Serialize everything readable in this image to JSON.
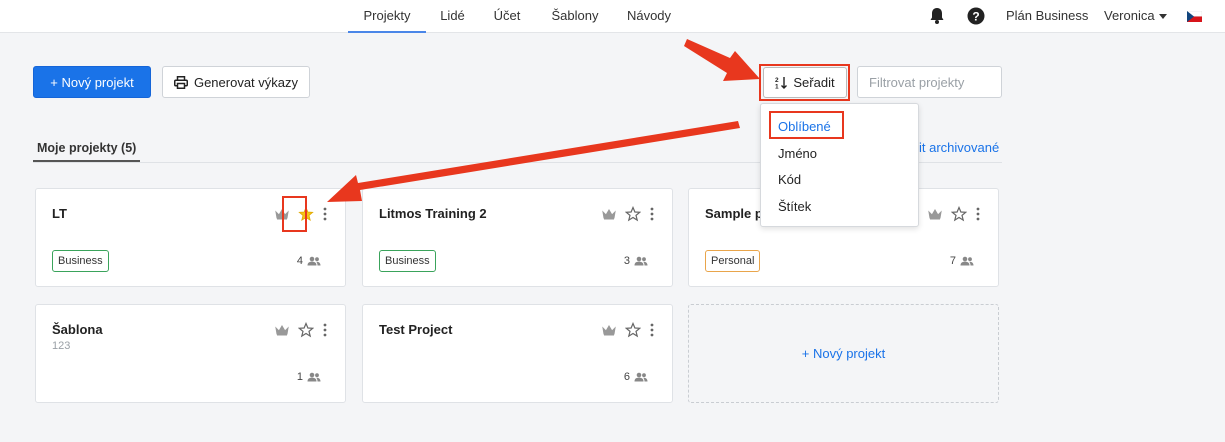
{
  "nav": {
    "items": [
      {
        "label": "Projekty",
        "active": true
      },
      {
        "label": "Lidé"
      },
      {
        "label": "Účet"
      },
      {
        "label": "Šablony"
      },
      {
        "label": "Návody"
      }
    ],
    "plan_label": "Plán Business",
    "user_name": "Veronica",
    "icons": [
      "bell-icon",
      "help-icon",
      "czech-flag-icon"
    ]
  },
  "toolbar": {
    "new_project_label": "+ Nový projekt",
    "reports_label": "Generovat výkazy",
    "sort_label": "Seřadit",
    "filter_placeholder": "Filtrovat projekty"
  },
  "sort_menu": {
    "options": [
      "Oblíbené",
      "Jméno",
      "Kód",
      "Štítek"
    ],
    "selected": "Oblíbené"
  },
  "section": {
    "tab_label": "Moje projekty (5)",
    "archived_link": "it archivované"
  },
  "projects": [
    {
      "name": "LT",
      "code": "",
      "badge": "Business",
      "members": "4",
      "favorite": true
    },
    {
      "name": "Litmos Training 2",
      "code": "",
      "badge": "Business",
      "members": "3",
      "favorite": false
    },
    {
      "name": "Sample pr",
      "code": "",
      "badge": "Personal",
      "members": "7",
      "favorite": false
    },
    {
      "name": "Šablona",
      "code": "123",
      "badge": "",
      "members": "1",
      "favorite": false
    },
    {
      "name": "Test Project",
      "code": "",
      "badge": "",
      "members": "6",
      "favorite": false
    }
  ],
  "new_project_card_label": "+ Nový projekt",
  "colors": {
    "accent": "#1a73e8",
    "annotation": "#e8371e",
    "favorite_star": "#f5c518",
    "badge_business": "#3aa35b",
    "badge_personal": "#e9a54b"
  }
}
